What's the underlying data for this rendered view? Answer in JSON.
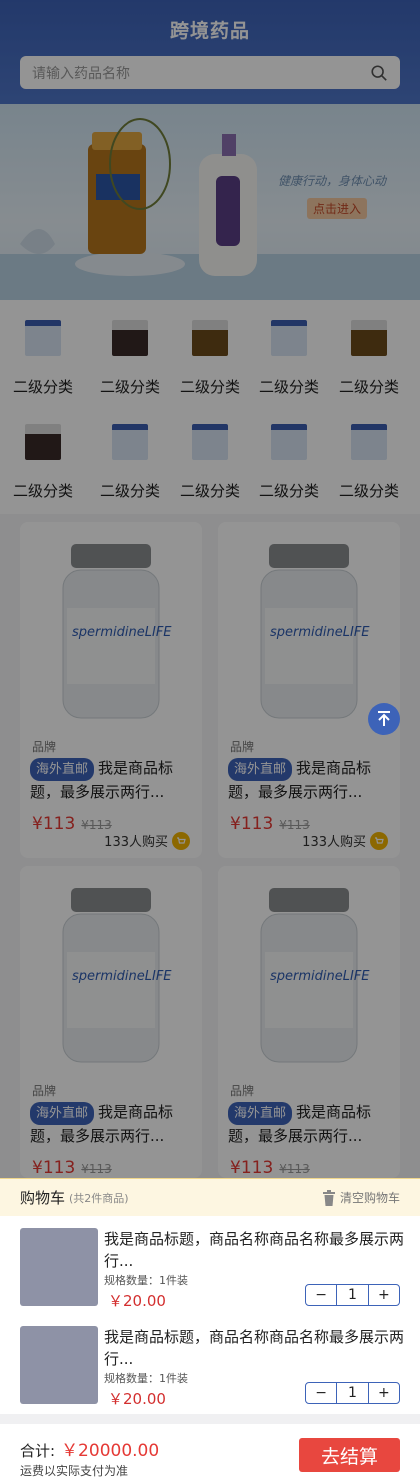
{
  "header": {
    "title": "跨境药品"
  },
  "search": {
    "placeholder": "请输入药品名称"
  },
  "banner": {
    "slogan": "健康行动，身体心动",
    "cta": "点击进入"
  },
  "categories": [
    {
      "label": "二级分类"
    },
    {
      "label": "二级分类"
    },
    {
      "label": "二级分类"
    },
    {
      "label": "二级分类"
    },
    {
      "label": "二级分类"
    },
    {
      "label": "二级分类"
    },
    {
      "label": "二级分类"
    },
    {
      "label": "二级分类"
    },
    {
      "label": "二级分类"
    },
    {
      "label": "二级分类"
    }
  ],
  "products": [
    {
      "brand": "品牌",
      "badge": "海外直邮",
      "title": "我是商品标题，最多展示两行...",
      "price": "¥113",
      "old": "¥113",
      "buyers": "133人购买"
    },
    {
      "brand": "品牌",
      "badge": "海外直邮",
      "title": "我是商品标题，最多展示两行...",
      "price": "¥113",
      "old": "¥113",
      "buyers": "133人购买"
    },
    {
      "brand": "品牌",
      "badge": "海外直邮",
      "title": "我是商品标题，最多展示两行...",
      "price": "¥113",
      "old": "¥113",
      "buyers": ""
    },
    {
      "brand": "品牌",
      "badge": "海外直邮",
      "title": "我是商品标题，最多展示两行...",
      "price": "¥113",
      "old": "¥113",
      "buyers": ""
    }
  ],
  "bottle_label": "spermidineLIFE",
  "cart": {
    "title": "购物车",
    "count": "(共2件商品)",
    "clear": "清空购物车",
    "items": [
      {
        "name": "我是商品标题，商品名称商品名称最多展示两行...",
        "spec": "规格数量：1件装",
        "price": "￥20.00",
        "qty": "1"
      },
      {
        "name": "我是商品标题，商品名称商品名称最多展示两行...",
        "spec": "规格数量：1件装",
        "price": "￥20.00",
        "qty": "1"
      }
    ],
    "total_label": "合计:",
    "total": "￥20000.00",
    "shipping_note": "运费以实际支付为准",
    "checkout": "去结算",
    "minus": "−",
    "plus": "+"
  }
}
